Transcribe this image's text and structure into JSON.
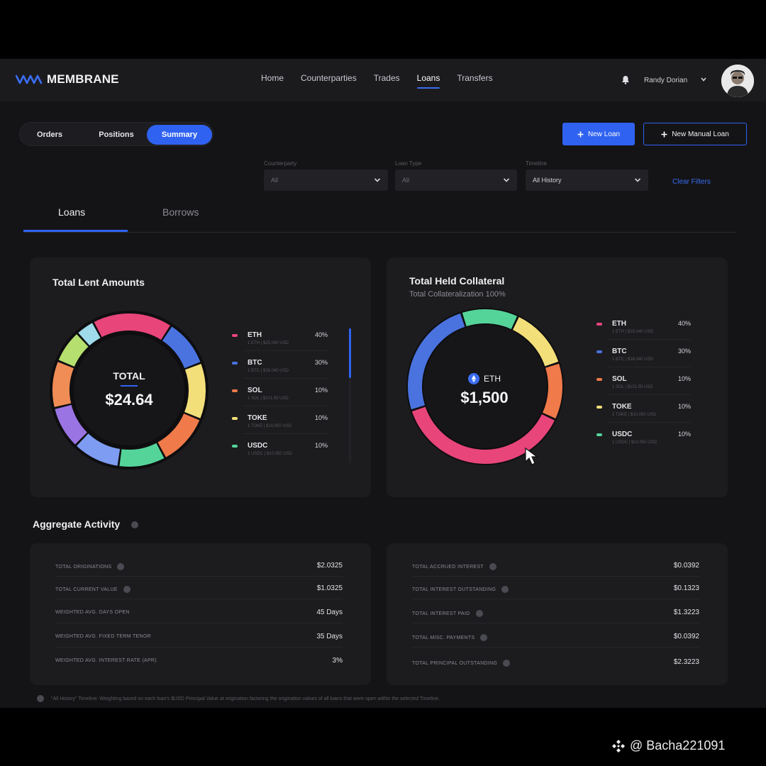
{
  "app": {
    "brand": "MEMBRANE",
    "accent": "#2f62f0"
  },
  "nav": {
    "items": [
      "Home",
      "Counterparties",
      "Trades",
      "Loans",
      "Transfers"
    ],
    "active": "Loans"
  },
  "user": {
    "name": "Randy Dorian"
  },
  "segmented": {
    "orders": "Orders",
    "positions": "Positions",
    "summary": "Summary",
    "active": "Summary"
  },
  "actions": {
    "new_loan": "New Loan",
    "new_manual_loan": "New Manual Loan"
  },
  "filters": {
    "counterparty": {
      "label": "Counterparty",
      "value": "All"
    },
    "loan_type": {
      "label": "Loan Type",
      "value": "All"
    },
    "timeline": {
      "label": "Timeline",
      "value": "All History"
    },
    "clear": "Clear Filters"
  },
  "subtabs": {
    "loans": "Loans",
    "borrows": "Borrows",
    "active": "Loans"
  },
  "lent": {
    "title": "Total Lent Amounts",
    "center_label": "TOTAL",
    "center_value": "$24.64",
    "legend": [
      {
        "symbol": "ETH",
        "pct": "40%",
        "detail": "1 ETH | $25,040 USD",
        "color": "#e8457a"
      },
      {
        "symbol": "BTC",
        "pct": "30%",
        "detail": "1 BTC | $36,040 USD",
        "color": "#4a73e0"
      },
      {
        "symbol": "SOL",
        "pct": "10%",
        "detail": "1 SOL | $101.55 USD",
        "color": "#f07a4a"
      },
      {
        "symbol": "TOKE",
        "pct": "10%",
        "detail": "1 TOKE | $10,050 USD",
        "color": "#f3df7a"
      },
      {
        "symbol": "USDC",
        "pct": "10%",
        "detail": "1 USDC | $10,050 USD",
        "color": "#55d49a"
      }
    ],
    "ring": [
      {
        "name": "pink",
        "share": 0.17,
        "color": "#e8457a"
      },
      {
        "name": "blue",
        "share": 0.1,
        "color": "#4a73e0"
      },
      {
        "name": "yellow",
        "share": 0.12,
        "color": "#f3df7a"
      },
      {
        "name": "orange",
        "share": 0.11,
        "color": "#f07a4a"
      },
      {
        "name": "green",
        "share": 0.1,
        "color": "#55d49a"
      },
      {
        "name": "light-blue",
        "share": 0.1,
        "color": "#7e9cf2"
      },
      {
        "name": "purple",
        "share": 0.09,
        "color": "#9b74e3"
      },
      {
        "name": "orange-2",
        "share": 0.1,
        "color": "#f08c55"
      },
      {
        "name": "lime",
        "share": 0.07,
        "color": "#b5df6e"
      },
      {
        "name": "cyan",
        "share": 0.04,
        "color": "#9fdbea"
      }
    ]
  },
  "collateral": {
    "title": "Total Held Collateral",
    "subtitle": "Total Collateralization 100%",
    "center_label": "ETH",
    "center_value": "$1,500",
    "legend": [
      {
        "symbol": "ETH",
        "pct": "40%",
        "detail": "1 ETH | $25,040 USD",
        "color": "#e8457a"
      },
      {
        "symbol": "BTC",
        "pct": "30%",
        "detail": "1 BTC | $36,040 USD",
        "color": "#4a73e0"
      },
      {
        "symbol": "SOL",
        "pct": "10%",
        "detail": "1 SOL | $101.55 USD",
        "color": "#f07a4a"
      },
      {
        "symbol": "TOKE",
        "pct": "10%",
        "detail": "1 TOKE | $10,050 USD",
        "color": "#f3df7a"
      },
      {
        "symbol": "USDC",
        "pct": "10%",
        "detail": "1 USDC | $10,050 USD",
        "color": "#55d49a"
      }
    ],
    "ring": [
      {
        "name": "green",
        "share": 0.12,
        "color": "#55d49a"
      },
      {
        "name": "yellow",
        "share": 0.13,
        "color": "#f3df7a"
      },
      {
        "name": "orange",
        "share": 0.12,
        "color": "#f07a4a"
      },
      {
        "name": "pink",
        "share": 0.38,
        "color": "#e8457a"
      },
      {
        "name": "blue",
        "share": 0.25,
        "color": "#4a73e0"
      }
    ]
  },
  "aggregate": {
    "title": "Aggregate Activity",
    "left": [
      {
        "label": "TOTAL ORIGINATIONS",
        "value": "$2.0325",
        "info": true
      },
      {
        "label": "TOTAL CURRENT VALUE",
        "value": "$1.0325",
        "info": true
      },
      {
        "label": "WEIGHTED AVG. DAYS OPEN",
        "value": "45 Days",
        "info": false
      },
      {
        "label": "WEIGHTED AVG. FIXED TERM TENOR",
        "value": "35 Days",
        "info": false
      },
      {
        "label": "WEIGHTED AVG. INTEREST RATE (APR)",
        "value": "3%",
        "info": false
      }
    ],
    "right": [
      {
        "label": "TOTAL ACCRUED INTEREST",
        "value": "$0.0392",
        "info": true
      },
      {
        "label": "TOTAL INTEREST OUTSTANDING",
        "value": "$0.1323",
        "info": true
      },
      {
        "label": "TOTAL INTEREST PAID",
        "value": "$1.3223",
        "info": true
      },
      {
        "label": "TOTAL MISC. PAYMENTS",
        "value": "$0.0392",
        "info": true
      },
      {
        "label": "TOTAL PRINCIPAL OUTSTANDING",
        "value": "$2.3223",
        "info": true
      }
    ]
  },
  "footnote": "\"All History\" Timeline: Weighting based on each loan's $USD Principal Value at origination factoring the origination values of all loans that were open within the selected Timeline.",
  "watermark": "@ Bacha221091"
}
